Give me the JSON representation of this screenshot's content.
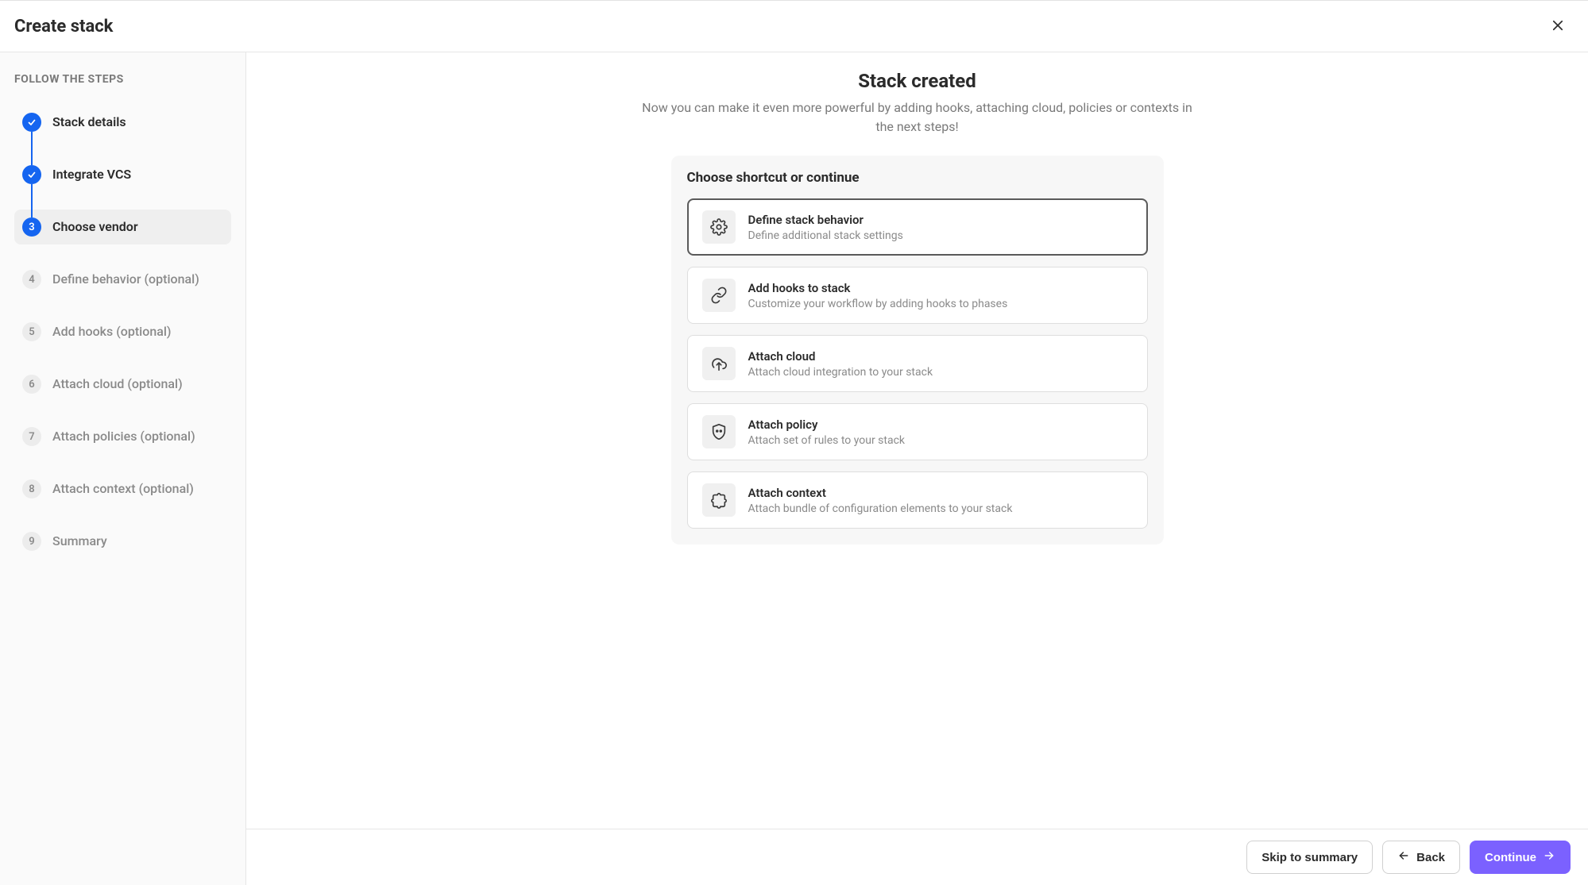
{
  "header": {
    "title": "Create stack"
  },
  "sidebar": {
    "heading": "FOLLOW THE STEPS",
    "steps": [
      {
        "label": "Stack details"
      },
      {
        "label": "Integrate VCS"
      },
      {
        "label": "Choose vendor",
        "number": "3"
      },
      {
        "label": "Define behavior (optional)",
        "number": "4"
      },
      {
        "label": "Add hooks (optional)",
        "number": "5"
      },
      {
        "label": "Attach cloud (optional)",
        "number": "6"
      },
      {
        "label": "Attach policies (optional)",
        "number": "7"
      },
      {
        "label": "Attach context (optional)",
        "number": "8"
      },
      {
        "label": "Summary",
        "number": "9"
      }
    ]
  },
  "main": {
    "title": "Stack created",
    "subtitle": "Now you can make it even more powerful by adding hooks, attaching cloud, policies or contexts in the next steps!",
    "panel_title": "Choose shortcut or continue",
    "options": [
      {
        "title": "Define stack behavior",
        "desc": "Define additional stack settings"
      },
      {
        "title": "Add hooks to stack",
        "desc": "Customize your workflow by adding hooks to phases"
      },
      {
        "title": "Attach cloud",
        "desc": "Attach cloud integration to your stack"
      },
      {
        "title": "Attach policy",
        "desc": "Attach set of rules to your stack"
      },
      {
        "title": "Attach context",
        "desc": "Attach bundle of configuration elements to your stack"
      }
    ]
  },
  "footer": {
    "skip": "Skip to summary",
    "back": "Back",
    "continue": "Continue"
  }
}
